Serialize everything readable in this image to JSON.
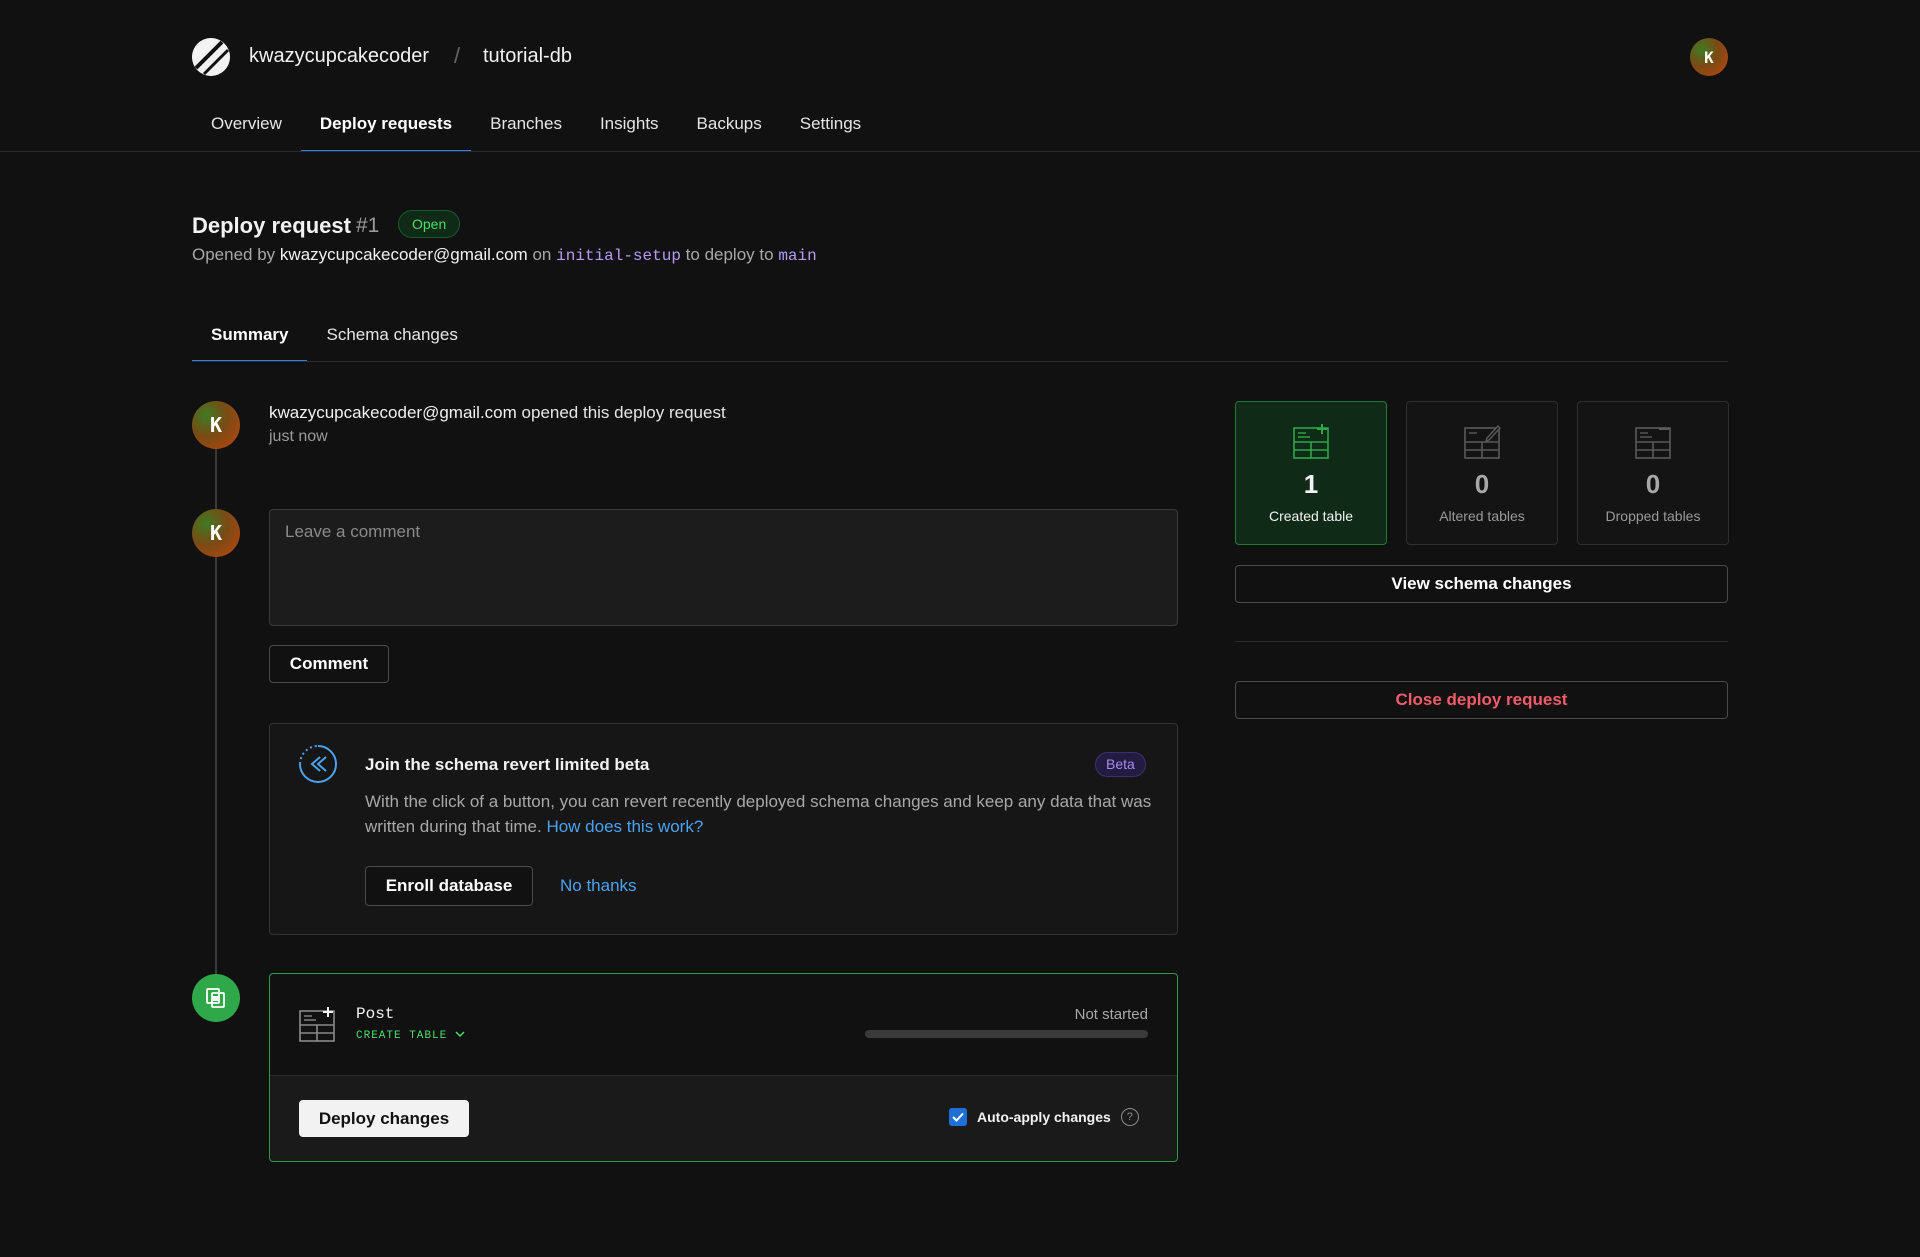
{
  "header": {
    "org": "kwazycupcakecoder",
    "separator": "/",
    "database": "tutorial-db",
    "avatar_letter": "K"
  },
  "nav": [
    {
      "label": "Overview",
      "active": false
    },
    {
      "label": "Deploy requests",
      "active": true
    },
    {
      "label": "Branches",
      "active": false
    },
    {
      "label": "Insights",
      "active": false
    },
    {
      "label": "Backups",
      "active": false
    },
    {
      "label": "Settings",
      "active": false
    }
  ],
  "request": {
    "title": "Deploy request",
    "number": "#1",
    "status": "Open",
    "opened_by_prefix": "Opened by",
    "author": "kwazycupcakecoder@gmail.com",
    "on_text": "on",
    "branch": "initial-setup",
    "to_text": "to deploy to",
    "target": "main"
  },
  "tabs": [
    {
      "label": "Summary",
      "active": true
    },
    {
      "label": "Schema changes",
      "active": false
    }
  ],
  "timeline": {
    "event_author": "kwazycupcakecoder@gmail.com",
    "event_action": "opened this deploy request",
    "event_time": "just now",
    "comment_placeholder": "Leave a comment",
    "comment_button": "Comment"
  },
  "beta": {
    "title": "Join the schema revert limited beta",
    "badge": "Beta",
    "description": "With the click of a button, you can revert recently deployed schema changes and keep any data that was written during that time.",
    "link": "How does this work?",
    "enroll_button": "Enroll database",
    "decline": "No thanks"
  },
  "deploy": {
    "table_name": "Post",
    "operation": "CREATE TABLE",
    "status": "Not started",
    "progress": 0,
    "deploy_button": "Deploy changes",
    "auto_apply_label": "Auto-apply changes",
    "auto_apply_checked": true,
    "help": "?"
  },
  "stats": [
    {
      "value": "1",
      "label": "Created table",
      "icon": "table-plus-icon"
    },
    {
      "value": "0",
      "label": "Altered tables",
      "icon": "table-edit-icon"
    },
    {
      "value": "0",
      "label": "Dropped tables",
      "icon": "table-minus-icon"
    }
  ],
  "actions": {
    "view_schema": "View schema changes",
    "close_request": "Close deploy request"
  },
  "colors": {
    "accent": "#2f80ed",
    "success": "#2fa84a",
    "danger": "#f25c6a",
    "link": "#4aa3f0",
    "beta": "#a58cf0"
  }
}
